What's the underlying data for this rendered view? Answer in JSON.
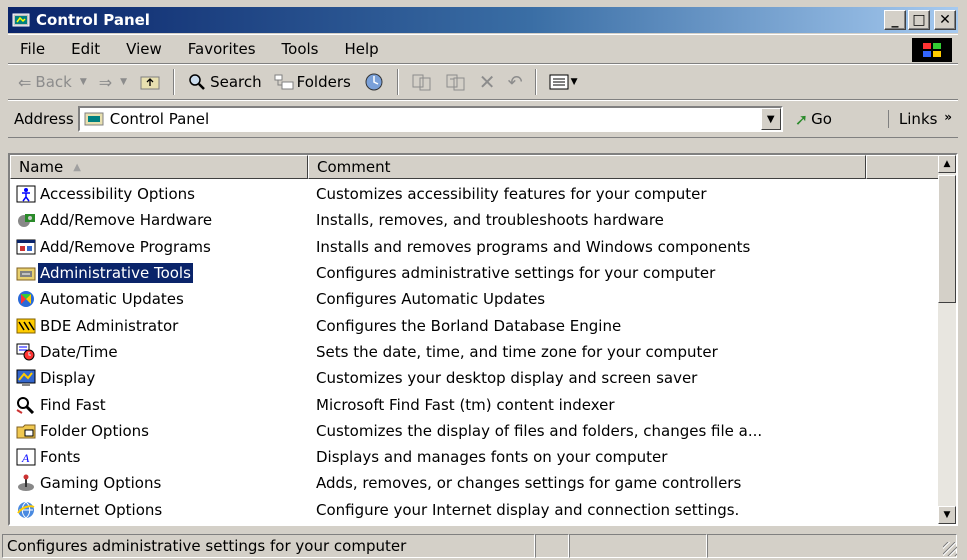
{
  "window": {
    "title": "Control Panel",
    "controls": {
      "minimize": "_",
      "maximize": "□",
      "close": "✕"
    }
  },
  "menu": [
    "File",
    "Edit",
    "View",
    "Favorites",
    "Tools",
    "Help"
  ],
  "toolbar": {
    "back": "Back",
    "search": "Search",
    "folders": "Folders"
  },
  "address": {
    "label": "Address",
    "value": "Control Panel",
    "go": "Go",
    "links": "Links"
  },
  "columns": {
    "name": "Name",
    "comment": "Comment"
  },
  "items": [
    {
      "name": "Accessibility Options",
      "comment": "Customizes accessibility features for your computer",
      "icon": "accessibility-icon"
    },
    {
      "name": "Add/Remove Hardware",
      "comment": "Installs, removes, and troubleshoots hardware",
      "icon": "hardware-icon"
    },
    {
      "name": "Add/Remove Programs",
      "comment": "Installs and removes programs and Windows components",
      "icon": "programs-icon"
    },
    {
      "name": "Administrative Tools",
      "comment": "Configures administrative settings for your computer",
      "icon": "admin-tools-icon"
    },
    {
      "name": "Automatic Updates",
      "comment": "Configures Automatic Updates",
      "icon": "updates-icon"
    },
    {
      "name": "BDE Administrator",
      "comment": "Configures the Borland Database Engine",
      "icon": "bde-icon"
    },
    {
      "name": "Date/Time",
      "comment": "Sets the date, time, and time zone for your computer",
      "icon": "datetime-icon"
    },
    {
      "name": "Display",
      "comment": "Customizes your desktop display and screen saver",
      "icon": "display-icon"
    },
    {
      "name": "Find Fast",
      "comment": "Microsoft Find Fast (tm) content indexer",
      "icon": "findfast-icon"
    },
    {
      "name": "Folder Options",
      "comment": "Customizes the display of files and folders, changes file a...",
      "icon": "folder-options-icon"
    },
    {
      "name": "Fonts",
      "comment": "Displays and manages fonts on your computer",
      "icon": "fonts-icon"
    },
    {
      "name": "Gaming Options",
      "comment": "Adds, removes, or changes settings for game controllers",
      "icon": "gaming-icon"
    },
    {
      "name": "Internet Options",
      "comment": "Configure your Internet display and connection settings.",
      "icon": "internet-icon"
    }
  ],
  "selected_item": "Administrative Tools",
  "status": {
    "text": "Configures administrative settings for your computer"
  },
  "colors": {
    "selection": "#0a246a",
    "title_start": "#0a246a",
    "title_end": "#a6caf0",
    "chrome": "#d4d0c8"
  }
}
